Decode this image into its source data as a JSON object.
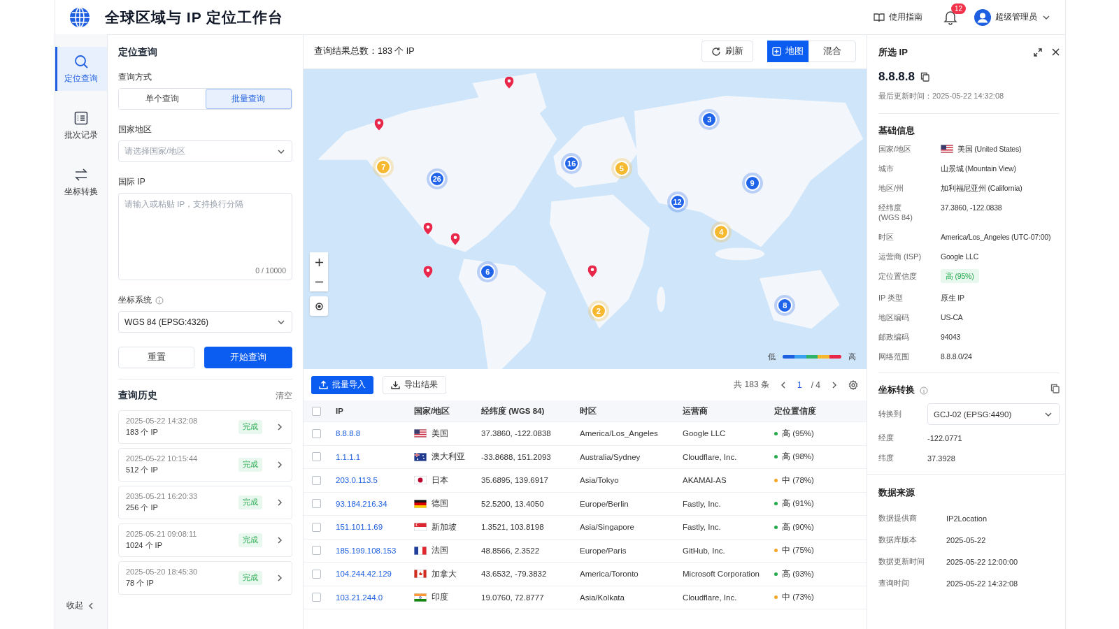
{
  "header": {
    "title": "全球区域与 IP 定位工作台",
    "guide": "使用指南",
    "notification_count": "12",
    "user": "超级管理员"
  },
  "nav": {
    "items": [
      {
        "label": "定位查询",
        "selected": true
      },
      {
        "label": "批次记录",
        "selected": false
      },
      {
        "label": "坐标转换",
        "selected": false
      }
    ],
    "collapse": "收起"
  },
  "query": {
    "title": "定位查询",
    "mode_label": "查询方式",
    "modes": [
      {
        "label": "单个查询",
        "selected": false
      },
      {
        "label": "批量查询",
        "selected": true
      }
    ],
    "country_label": "国家地区",
    "country_placeholder": "请选择国家/地区",
    "ip_label": "国际 IP",
    "ip_placeholder": "请输入或粘贴 IP，支持换行分隔",
    "ip_count": "0 / 10000",
    "crs_label": "坐标系统",
    "crs_value": "WGS 84 (EPSG:4326)",
    "reset": "重置",
    "submit": "开始查询"
  },
  "history": {
    "title": "查询历史",
    "clear": "清空",
    "items": [
      {
        "time": "2025-05-22 14:32:08",
        "count": "183 个 IP",
        "status": "完成"
      },
      {
        "time": "2025-05-22 10:15:44",
        "count": "512 个 IP",
        "status": "完成"
      },
      {
        "time": "2035-05-21 16:20:33",
        "count": "256 个 IP",
        "status": "完成"
      },
      {
        "time": "2025-05-21 09:08:11",
        "count": "1024 个 IP",
        "status": "完成"
      },
      {
        "time": "2025-05-20 18:45:30",
        "count": "78 个 IP",
        "status": "完成"
      }
    ]
  },
  "results": {
    "total": "查询结果总数：183 个 IP",
    "refresh": "刷新",
    "views": [
      {
        "label": "地图",
        "selected": true
      },
      {
        "label": "混合",
        "selected": false
      }
    ]
  },
  "map": {
    "markers": [
      {
        "kind": "cluster",
        "count": "7",
        "color": "#f5b82e"
      },
      {
        "kind": "cluster",
        "count": "26",
        "color": "#1e63e9"
      },
      {
        "kind": "cluster",
        "count": "16",
        "color": "#1e63e9"
      },
      {
        "kind": "cluster",
        "count": "5",
        "color": "#f5b82e"
      },
      {
        "kind": "cluster",
        "count": "3",
        "color": "#1e63e9"
      },
      {
        "kind": "cluster",
        "count": "9",
        "color": "#1e63e9"
      },
      {
        "kind": "cluster",
        "count": "12",
        "color": "#1e63e9"
      },
      {
        "kind": "cluster",
        "count": "4",
        "color": "#f5b82e"
      },
      {
        "kind": "cluster",
        "count": "6",
        "color": "#1e63e9"
      },
      {
        "kind": "cluster",
        "count": "2",
        "color": "#f5b82e"
      },
      {
        "kind": "cluster",
        "count": "8",
        "color": "#1e63e9"
      },
      {
        "kind": "pin",
        "color": "#e8274b"
      },
      {
        "kind": "pin",
        "color": "#e8274b"
      },
      {
        "kind": "pin",
        "color": "#e8274b"
      },
      {
        "kind": "pin",
        "color": "#e8274b"
      },
      {
        "kind": "pin",
        "color": "#e8274b"
      },
      {
        "kind": "pin",
        "color": "#e8274b"
      }
    ],
    "legend_low": "低",
    "legend_high": "高"
  },
  "table": {
    "import": "批量导入",
    "export": "导出结果",
    "total": "共 183 条",
    "page": "1",
    "pages": "/ 4",
    "all_checked": false,
    "columns": [
      "IP",
      "国家/地区",
      "经纬度 (WGS 84)",
      "时区",
      "运营商",
      "定位置信度"
    ],
    "rows": [
      {
        "checked": false,
        "ip": "8.8.8.8",
        "country": "美国",
        "coords": "37.3860, -122.0838",
        "timezone": "America/Los_Angeles",
        "isp": "Google LLC",
        "confidence": "高 (95%)",
        "color": "#22a94a"
      },
      {
        "checked": false,
        "ip": "1.1.1.1",
        "country": "澳大利亚",
        "coords": "-33.8688, 151.2093",
        "timezone": "Australia/Sydney",
        "isp": "Cloudflare, Inc.",
        "confidence": "高 (98%)",
        "color": "#22a94a"
      },
      {
        "checked": false,
        "ip": "203.0.113.5",
        "country": "日本",
        "coords": "35.6895, 139.6917",
        "timezone": "Asia/Tokyo",
        "isp": "AKAMAI-AS",
        "confidence": "中 (78%)",
        "color": "#f5a623"
      },
      {
        "checked": false,
        "ip": "93.184.216.34",
        "country": "德国",
        "coords": "52.5200, 13.4050",
        "timezone": "Europe/Berlin",
        "isp": "Fastly, Inc.",
        "confidence": "高 (91%)",
        "color": "#22a94a"
      },
      {
        "checked": false,
        "ip": "151.101.1.69",
        "country": "新加坡",
        "coords": "1.3521, 103.8198",
        "timezone": "Asia/Singapore",
        "isp": "Fastly, Inc.",
        "confidence": "高 (90%)",
        "color": "#22a94a"
      },
      {
        "checked": false,
        "ip": "185.199.108.153",
        "country": "法国",
        "coords": "48.8566, 2.3522",
        "timezone": "Europe/Paris",
        "isp": "GitHub, Inc.",
        "confidence": "中 (75%)",
        "color": "#f5a623"
      },
      {
        "checked": false,
        "ip": "104.244.42.129",
        "country": "加拿大",
        "coords": "43.6532, -79.3832",
        "timezone": "America/Toronto",
        "isp": "Microsoft Corporation",
        "confidence": "高 (93%)",
        "color": "#22a94a"
      },
      {
        "checked": false,
        "ip": "103.21.244.0",
        "country": "印度",
        "coords": "19.0760, 72.8777",
        "timezone": "Asia/Kolkata",
        "isp": "Cloudflare, Inc.",
        "confidence": "中 (73%)",
        "color": "#f5a623"
      }
    ]
  },
  "detail": {
    "title": "所选 IP",
    "ip": "8.8.8.8",
    "updated": "最后更新时间：2025-05-22 14:32:08",
    "basic_title": "基础信息",
    "basic": [
      {
        "kind": "flag",
        "label": "国家/地区",
        "value": "美国 (United States)"
      },
      {
        "kind": "text",
        "label": "城市",
        "value": "山景城 (Mountain View)"
      },
      {
        "kind": "text",
        "label": "地区/州",
        "value": "加利福尼亚州 (California)"
      },
      {
        "kind": "text",
        "label": "经纬度 (WGS 84)",
        "value": "37.3860, -122.0838"
      },
      {
        "kind": "text",
        "label": "时区",
        "value": "America/Los_Angeles (UTC-07:00)"
      },
      {
        "kind": "text",
        "label": "运营商 (ISP)",
        "value": "Google LLC"
      },
      {
        "kind": "badge",
        "label": "定位置信度",
        "value": "高 (95%)"
      },
      {
        "kind": "text",
        "label": "IP 类型",
        "value": "原生 IP"
      },
      {
        "kind": "text",
        "label": "地区编码",
        "value": "US-CA"
      },
      {
        "kind": "text",
        "label": "邮政编码",
        "value": "94043"
      },
      {
        "kind": "text",
        "label": "网络范围",
        "value": "8.8.8.0/24"
      }
    ],
    "convert_title": "坐标转换",
    "convert_label": "转换到",
    "convert_value": "GCJ-02 (EPSG:4490)",
    "converted": [
      {
        "label": "经度",
        "value": "-122.0771"
      },
      {
        "label": "纬度",
        "value": "37.3928"
      }
    ],
    "source_title": "数据来源",
    "source": [
      {
        "label": "数据提供商",
        "value": "IP2Location"
      },
      {
        "label": "数据库版本",
        "value": "2025-05-22"
      },
      {
        "label": "数据更新时间",
        "value": "2025-05-22 12:00:00"
      },
      {
        "label": "查询时间",
        "value": "2025-05-22 14:32:08"
      }
    ]
  }
}
